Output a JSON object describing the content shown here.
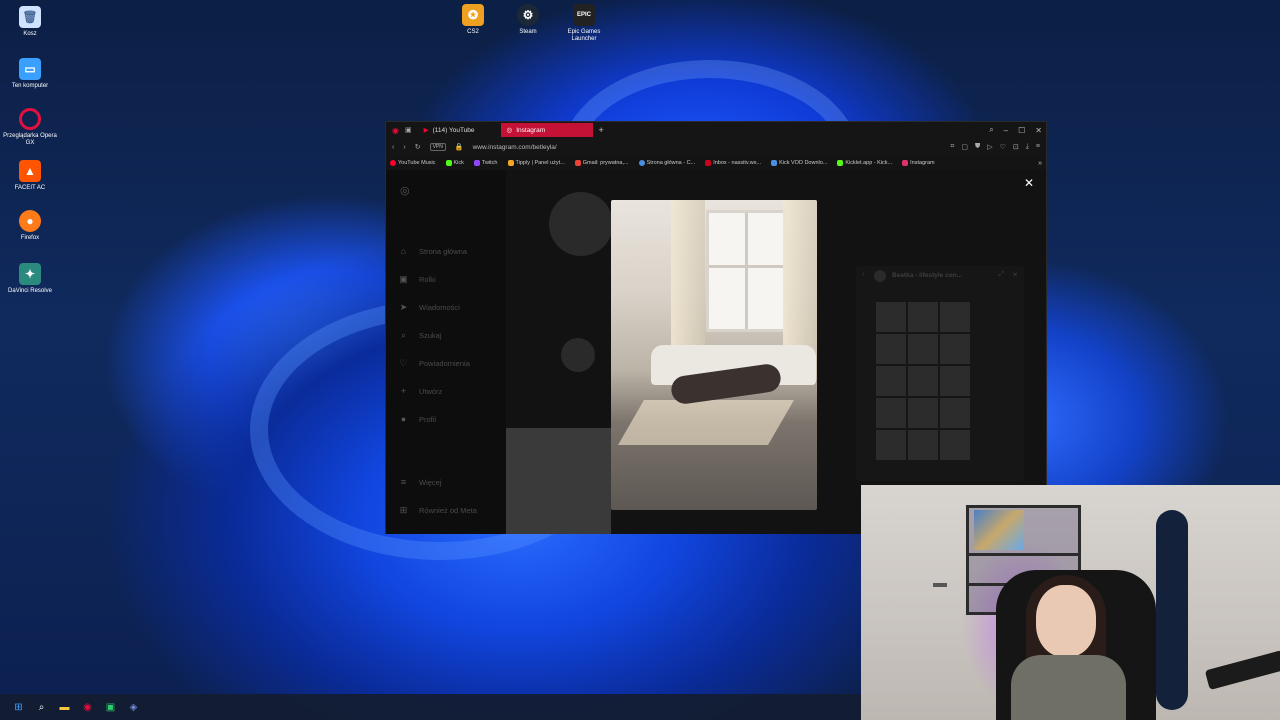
{
  "desktop": {
    "icons": [
      {
        "label": "Kosz",
        "icon": "recycle-bin-icon",
        "color": "#cfe3ff"
      },
      {
        "label": "Ten komputer",
        "icon": "computer-icon",
        "color": "#3aa0ff"
      },
      {
        "label": "Przeglądarka Opera GX",
        "icon": "opera-gx-icon",
        "color": "#e0113f"
      },
      {
        "label": "FACEIT AC",
        "icon": "faceit-icon",
        "color": "#ff5500"
      },
      {
        "label": "Firefox",
        "icon": "firefox-icon",
        "color": "#ff7a18"
      },
      {
        "label": "DaVinci Resolve",
        "icon": "davinci-resolve-icon",
        "color": "#2b8a7e"
      },
      {
        "label": "CS2",
        "icon": "cs2-icon",
        "color": "#f0a020"
      },
      {
        "label": "Steam",
        "icon": "steam-icon",
        "color": "#1b2838"
      },
      {
        "label": "Epic Games Launcher",
        "icon": "epic-games-icon",
        "color": "#222222"
      }
    ]
  },
  "browser": {
    "tabs": [
      {
        "label": "(114) YouTube",
        "icon": "youtube-icon"
      },
      {
        "label": "Instagram",
        "icon": "instagram-icon"
      }
    ],
    "new_tab": "+",
    "url": "www.instagram.com/betleyla/",
    "vpn": "VPN",
    "bookmarks": [
      {
        "label": "YouTube Music",
        "color": "#ff0033"
      },
      {
        "label": "Kick",
        "color": "#53fc18"
      },
      {
        "label": "Twitch",
        "color": "#9146ff"
      },
      {
        "label": "Tipply | Panel użyt...",
        "color": "#f5a623"
      },
      {
        "label": "Gmail: prywatna,...",
        "color": "#ea4335"
      },
      {
        "label": "Strona główna - C...",
        "color": "#4a90e2"
      },
      {
        "label": "Inbox - nassitv.ws...",
        "color": "#d0021b"
      },
      {
        "label": "Kick VOD Downlo...",
        "color": "#53fc18"
      },
      {
        "label": "Kicklet.app - Kick...",
        "color": "#53fc18"
      },
      {
        "label": "Instagram",
        "color": "#e1306c"
      }
    ],
    "more": "»"
  },
  "instagram": {
    "nav": [
      {
        "label": "Strona główna",
        "icon": "home-icon"
      },
      {
        "label": "Rolki",
        "icon": "reels-icon"
      },
      {
        "label": "Wiadomości",
        "icon": "messages-icon"
      },
      {
        "label": "Szukaj",
        "icon": "search-icon"
      },
      {
        "label": "Powiadomienia",
        "icon": "heart-icon"
      },
      {
        "label": "Utwórz",
        "icon": "plus-icon"
      },
      {
        "label": "Profil",
        "icon": "profile-icon"
      },
      {
        "label": "Więcej",
        "icon": "menu-icon"
      },
      {
        "label": "Również od Meta",
        "icon": "meta-icon"
      }
    ],
    "side_panel_title": "Beatka - lifestyle con..."
  },
  "taskbar": {
    "items": [
      "start-icon",
      "search-icon",
      "file-explorer-icon",
      "opera-gx-icon",
      "app-icon",
      "discord-icon"
    ]
  }
}
